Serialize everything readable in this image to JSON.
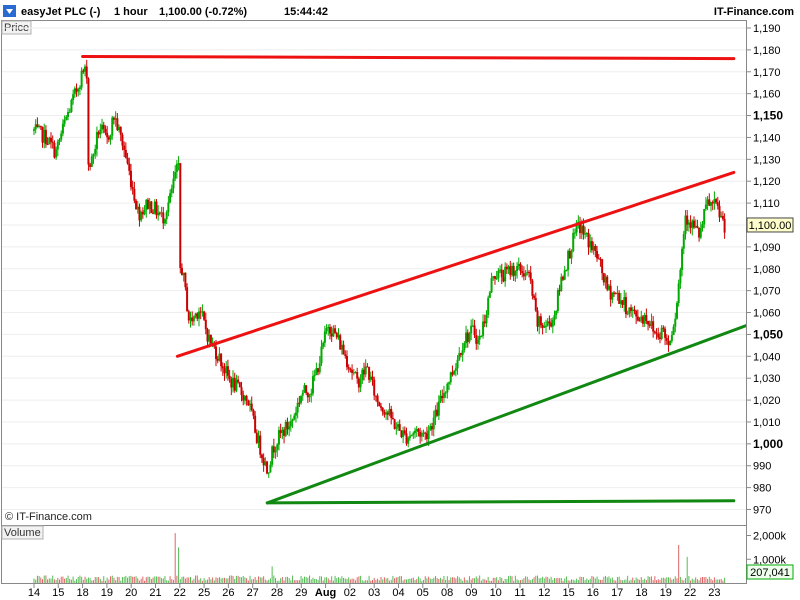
{
  "header": {
    "title": "easyJet PLC (-)",
    "timeframe": "1 hour",
    "last_price": "1,100.00 (-0.72%)",
    "time": "15:44:42",
    "brand": "IT-Finance.com"
  },
  "price_panel": {
    "label": "Price",
    "watermark": "© IT-Finance.com"
  },
  "volume_panel": {
    "label": "Volume",
    "current_value": "207,041"
  },
  "colors": {
    "up_candle": "#00aa00",
    "down_candle": "#cc0000",
    "resistance_line": "#ee1111",
    "support_line": "#118811",
    "panel_border": "#888888",
    "grid": "#eeeeee"
  },
  "chart_data": {
    "type": "candlestick",
    "instrument": "easyJet PLC (-)",
    "interval": "1 hour",
    "y_axis": {
      "min": 970,
      "max": 1190,
      "ticks": [
        970,
        980,
        990,
        1000,
        1010,
        1020,
        1030,
        1040,
        1050,
        1060,
        1070,
        1080,
        1090,
        1100,
        1110,
        1120,
        1130,
        1140,
        1150,
        1160,
        1170,
        1180,
        1190
      ],
      "tick_labels": [
        "970",
        "980",
        "990",
        "1,000",
        "1,010",
        "1,020",
        "1,030",
        "1,040",
        "1,050",
        "1,060",
        "1,070",
        "1,080",
        "1,090",
        "1,100",
        "1,110",
        "1,120",
        "1,130",
        "1,140",
        "1,150",
        "1,160",
        "1,170",
        "1,180",
        "1,190"
      ],
      "major_ticks": [
        1000,
        1050,
        1150
      ],
      "current_value": 1100,
      "current_value_label": "1,100.00"
    },
    "x_axis": {
      "ticks": [
        {
          "label": "14",
          "major": false
        },
        {
          "label": "15",
          "major": false
        },
        {
          "label": "18",
          "major": false
        },
        {
          "label": "19",
          "major": false
        },
        {
          "label": "20",
          "major": false
        },
        {
          "label": "21",
          "major": false
        },
        {
          "label": "22",
          "major": false
        },
        {
          "label": "25",
          "major": false
        },
        {
          "label": "26",
          "major": false
        },
        {
          "label": "27",
          "major": false
        },
        {
          "label": "28",
          "major": false
        },
        {
          "label": "29",
          "major": false
        },
        {
          "label": "Aug",
          "major": true
        },
        {
          "label": "02",
          "major": false
        },
        {
          "label": "03",
          "major": false
        },
        {
          "label": "04",
          "major": false
        },
        {
          "label": "05",
          "major": false
        },
        {
          "label": "08",
          "major": false
        },
        {
          "label": "09",
          "major": false
        },
        {
          "label": "10",
          "major": false
        },
        {
          "label": "11",
          "major": false
        },
        {
          "label": "12",
          "major": false
        },
        {
          "label": "15",
          "major": false
        },
        {
          "label": "16",
          "major": false
        },
        {
          "label": "17",
          "major": false
        },
        {
          "label": "18",
          "major": false
        },
        {
          "label": "19",
          "major": false
        },
        {
          "label": "22",
          "major": false
        },
        {
          "label": "23",
          "major": false
        }
      ]
    },
    "price_path": [
      {
        "x": 0.0,
        "y": 1143
      },
      {
        "x": 0.5,
        "y": 1140
      },
      {
        "x": 0.9,
        "y": 1133
      },
      {
        "x": 1.3,
        "y": 1148
      },
      {
        "x": 1.7,
        "y": 1160
      },
      {
        "x": 2.0,
        "y": 1170
      },
      {
        "x": 2.35,
        "y": 1128
      },
      {
        "x": 2.7,
        "y": 1145
      },
      {
        "x": 3.0,
        "y": 1138
      },
      {
        "x": 3.3,
        "y": 1150
      },
      {
        "x": 3.7,
        "y": 1135
      },
      {
        "x": 4.0,
        "y": 1120
      },
      {
        "x": 4.3,
        "y": 1105
      },
      {
        "x": 4.7,
        "y": 1110
      },
      {
        "x": 5.0,
        "y": 1107
      },
      {
        "x": 5.3,
        "y": 1103
      },
      {
        "x": 5.6,
        "y": 1112
      },
      {
        "x": 5.85,
        "y": 1125
      },
      {
        "x": 6.1,
        "y": 1080
      },
      {
        "x": 6.4,
        "y": 1055
      },
      {
        "x": 6.8,
        "y": 1062
      },
      {
        "x": 7.2,
        "y": 1048
      },
      {
        "x": 7.6,
        "y": 1040
      },
      {
        "x": 8.0,
        "y": 1030
      },
      {
        "x": 8.4,
        "y": 1025
      },
      {
        "x": 8.8,
        "y": 1020
      },
      {
        "x": 9.2,
        "y": 1002
      },
      {
        "x": 9.6,
        "y": 988
      },
      {
        "x": 9.9,
        "y": 1000
      },
      {
        "x": 10.2,
        "y": 1005
      },
      {
        "x": 10.6,
        "y": 1010
      },
      {
        "x": 11.0,
        "y": 1023
      },
      {
        "x": 11.4,
        "y": 1025
      },
      {
        "x": 11.8,
        "y": 1040
      },
      {
        "x": 12.1,
        "y": 1055
      },
      {
        "x": 12.5,
        "y": 1048
      },
      {
        "x": 12.9,
        "y": 1038
      },
      {
        "x": 13.3,
        "y": 1028
      },
      {
        "x": 13.7,
        "y": 1035
      },
      {
        "x": 14.1,
        "y": 1020
      },
      {
        "x": 14.5,
        "y": 1015
      },
      {
        "x": 14.9,
        "y": 1008
      },
      {
        "x": 15.3,
        "y": 1003
      },
      {
        "x": 15.7,
        "y": 1006
      },
      {
        "x": 16.1,
        "y": 1004
      },
      {
        "x": 16.5,
        "y": 1012
      },
      {
        "x": 16.9,
        "y": 1025
      },
      {
        "x": 17.3,
        "y": 1035
      },
      {
        "x": 17.7,
        "y": 1048
      },
      {
        "x": 18.1,
        "y": 1052
      },
      {
        "x": 18.3,
        "y": 1046
      },
      {
        "x": 18.6,
        "y": 1060
      },
      {
        "x": 18.9,
        "y": 1078
      },
      {
        "x": 19.3,
        "y": 1077
      },
      {
        "x": 19.7,
        "y": 1080
      },
      {
        "x": 20.1,
        "y": 1079
      },
      {
        "x": 20.4,
        "y": 1076
      },
      {
        "x": 20.7,
        "y": 1055
      },
      {
        "x": 21.1,
        "y": 1054
      },
      {
        "x": 21.4,
        "y": 1058
      },
      {
        "x": 21.7,
        "y": 1075
      },
      {
        "x": 22.1,
        "y": 1090
      },
      {
        "x": 22.4,
        "y": 1100
      },
      {
        "x": 22.8,
        "y": 1093
      },
      {
        "x": 23.2,
        "y": 1085
      },
      {
        "x": 23.6,
        "y": 1070
      },
      {
        "x": 24.0,
        "y": 1068
      },
      {
        "x": 24.4,
        "y": 1062
      },
      {
        "x": 24.8,
        "y": 1058
      },
      {
        "x": 25.2,
        "y": 1058
      },
      {
        "x": 25.6,
        "y": 1050
      },
      {
        "x": 25.9,
        "y": 1052
      },
      {
        "x": 26.1,
        "y": 1045
      },
      {
        "x": 26.4,
        "y": 1060
      },
      {
        "x": 26.6,
        "y": 1080
      },
      {
        "x": 26.8,
        "y": 1105
      },
      {
        "x": 27.1,
        "y": 1100
      },
      {
        "x": 27.4,
        "y": 1095
      },
      {
        "x": 27.7,
        "y": 1110
      },
      {
        "x": 28.1,
        "y": 1108
      },
      {
        "x": 28.4,
        "y": 1100
      }
    ],
    "trendlines": [
      {
        "name": "resistance-horizontal",
        "color": "red",
        "points": [
          {
            "x": 2.0,
            "y": 1177
          },
          {
            "x": 28.8,
            "y": 1176
          }
        ]
      },
      {
        "name": "channel-top",
        "color": "red",
        "points": [
          {
            "x": 5.9,
            "y": 1040
          },
          {
            "x": 28.8,
            "y": 1124
          }
        ]
      },
      {
        "name": "channel-bottom",
        "color": "green",
        "points": [
          {
            "x": 9.6,
            "y": 973
          },
          {
            "x": 29.3,
            "y": 1054
          }
        ]
      },
      {
        "name": "support-horizontal",
        "color": "green",
        "points": [
          {
            "x": 9.6,
            "y": 973
          },
          {
            "x": 28.8,
            "y": 974
          }
        ]
      }
    ],
    "volume": {
      "label": "Volume",
      "y_ticks": [
        "1,000k",
        "2,000k"
      ],
      "current_value": "207,041",
      "spikes": [
        {
          "x": 5.8,
          "v": 2100
        },
        {
          "x": 5.95,
          "v": 1500
        },
        {
          "x": 9.8,
          "v": 700
        },
        {
          "x": 26.5,
          "v": 1600
        },
        {
          "x": 26.9,
          "v": 1100
        }
      ]
    }
  }
}
